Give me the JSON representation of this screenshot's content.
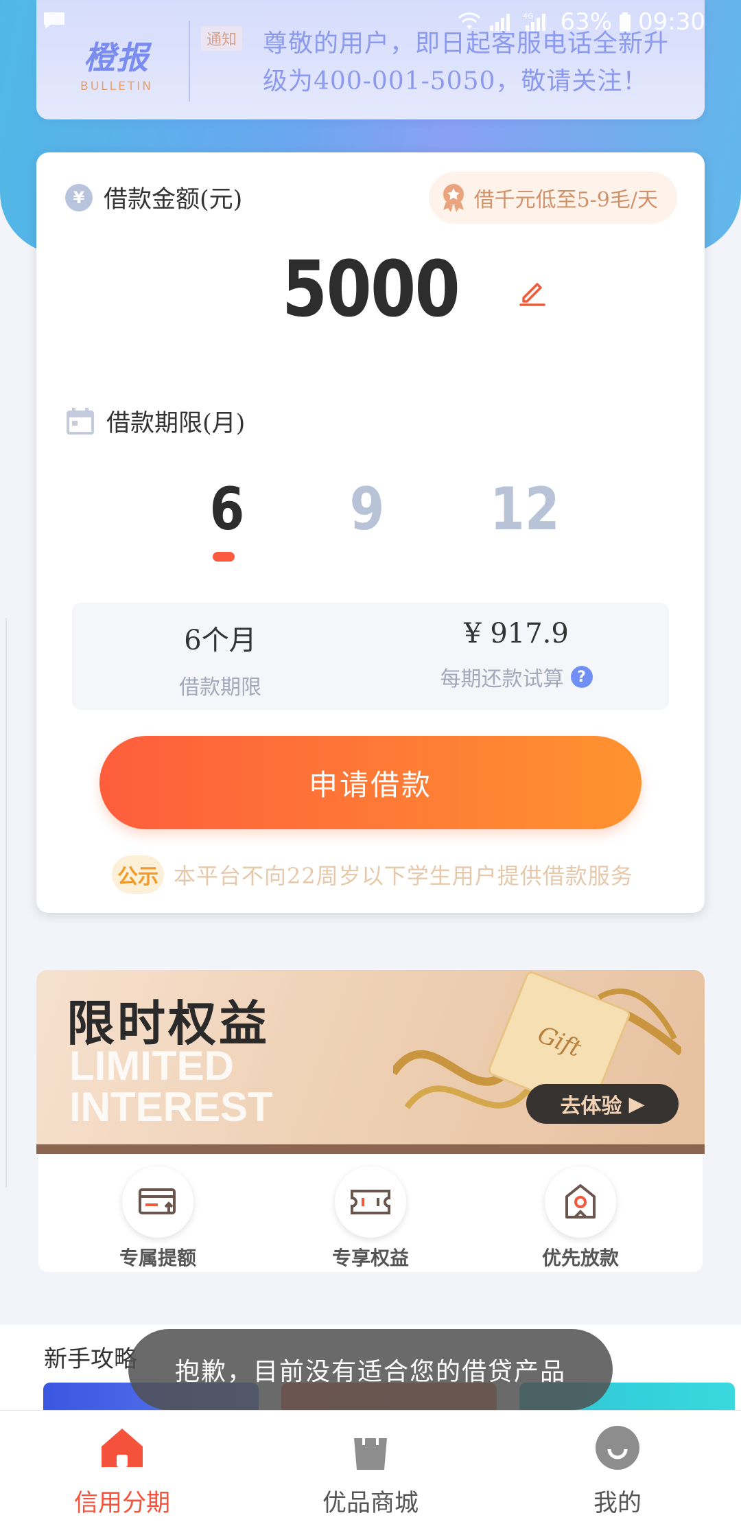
{
  "status_bar": {
    "battery": "63%",
    "time": "09:30",
    "network": "4G"
  },
  "bulletin": {
    "logo_main": "橙报",
    "logo_sub": "BULLETIN",
    "tag": "通知",
    "text": "尊敬的用户，即日起客服电话全新升级为400-001-5050，敬请关注！"
  },
  "loan": {
    "amount_label": "借款金额(元)",
    "promo": "借千元低至5-9毛/天",
    "amount": "5000",
    "term_label": "借款期限(月)",
    "terms": [
      "6",
      "9",
      "12"
    ],
    "selected_term": "6",
    "summary": {
      "term_value": "6个月",
      "term_caption": "借款期限",
      "payment_value": "¥ 917.9",
      "payment_caption": "每期还款试算"
    },
    "apply_button": "申请借款",
    "notice_badge": "公示",
    "notice_text": "本平台不向22周岁以下学生用户提供借款服务"
  },
  "banner": {
    "title": "限时权益",
    "subtitle_line1": "LIMITED",
    "subtitle_line2": "INTEREST",
    "gift_text": "Gift",
    "cta": "去体验"
  },
  "benefits": [
    {
      "label": "专属提额",
      "icon": "credit-card-up-icon"
    },
    {
      "label": "专享权益",
      "icon": "ticket-icon"
    },
    {
      "label": "优先放款",
      "icon": "priority-house-icon"
    }
  ],
  "guide": {
    "title": "新手攻略"
  },
  "toast": "抱歉，目前没有适合您的借贷产品",
  "bottom_nav": [
    {
      "label": "信用分期",
      "icon": "home-icon",
      "active": true
    },
    {
      "label": "优品商城",
      "icon": "shopping-bag-icon",
      "active": false
    },
    {
      "label": "我的",
      "icon": "profile-icon",
      "active": false
    }
  ],
  "colors": {
    "accent": "#f5523c",
    "button_start": "#fe5d3c",
    "button_end": "#ff9330",
    "bulletin_text": "#8c9aee"
  }
}
